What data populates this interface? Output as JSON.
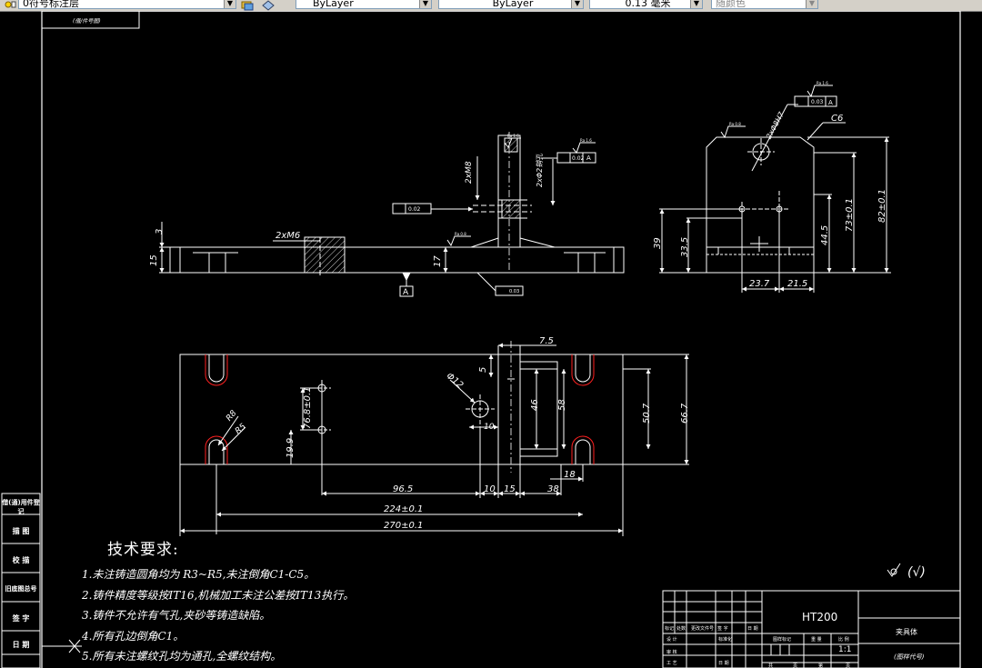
{
  "toolbar": {
    "layer_value": "0符号标注层",
    "color_value": "ByLayer",
    "linetype_value": "ByLayer",
    "lineweight_value": "0.13 毫米",
    "plotstyle_value": "随颜色"
  },
  "drawing": {
    "top_tag": "(借/件号图)",
    "side_labels": [
      "借(通)用件登记",
      "描 图",
      "校 描",
      "旧底图总号",
      "签 字",
      "日 期"
    ],
    "front_view": {
      "dims": [
        "3",
        "15",
        "2xM6",
        "17",
        "2xM8",
        "2xΦ2销孔"
      ],
      "datum": "A",
      "gdt_parallel_tol": "0.02",
      "gdt_parallel2_tol": "0.02",
      "gdt_parallel2_datum": "A",
      "gdt_flat_tol": "0.03",
      "roughness": [
        "Ra 0.8",
        "Ra 1.6",
        "Ra 1.6"
      ]
    },
    "side_view": {
      "dims": [
        "2xΦ8H7",
        "C6",
        "39",
        "33.5",
        "44.5",
        "73±0.1",
        "82±0.1",
        "23.7",
        "21.5"
      ],
      "gdt_tol": "0.03",
      "gdt_datum": "A",
      "roughness": [
        "Ra 0.8",
        "Ra 1.6"
      ]
    },
    "plan_view": {
      "dims": [
        "7.5",
        "5",
        "Φ12",
        "46",
        "58",
        "50.7",
        "66.7",
        "R8",
        "R5",
        "76.8±0.1",
        "19.9",
        "10",
        "96.5",
        "10",
        "15",
        "38",
        "18",
        "224±0.1",
        "270±0.1"
      ]
    },
    "tech_req": {
      "title": "技术要求:",
      "lines": [
        "1.未注铸造圆角均为 R3~R5,未注倒角C1-C5。",
        "2.铸件精度等级按IT16,机械加工未注公差按IT13执行。",
        "3.铸件不允许有气孔,夹砂等铸造缺陷。",
        "4.所有孔边倒角C1。",
        "5.所有未注螺纹孔均为通孔,全螺纹结构。"
      ]
    },
    "roughness_note": "(√)",
    "title_block": {
      "material": "HT200",
      "part_name": "夹具体",
      "drawing_code": "(图样代号)",
      "scale": "1:1",
      "header_small": [
        "标记",
        "处数",
        "更改文件号",
        "签 字",
        "日 期"
      ],
      "row_labels": [
        "设 计",
        "标准化",
        "审 核",
        "工 艺",
        "日 期"
      ],
      "cols": [
        "图样标记",
        "重 量",
        "比 例"
      ],
      "sheet": [
        "共",
        "页",
        "第",
        "页"
      ]
    }
  }
}
